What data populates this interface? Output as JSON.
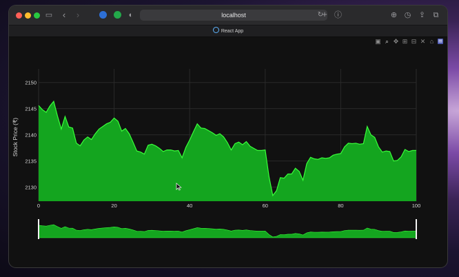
{
  "browser": {
    "url": "localhost",
    "tab_title": "React App"
  },
  "colors": {
    "fill": "#14a51f",
    "line": "#39ff3a",
    "grid": "#2a2a2a",
    "background": "#111111"
  },
  "modebar": {
    "icons": [
      "camera-icon",
      "zoom-icon",
      "pan-icon",
      "zoom-in-icon",
      "zoom-out-icon",
      "autoscale-icon",
      "reset-axes-icon",
      "plotly-logo-icon"
    ]
  },
  "chart_data": {
    "type": "area",
    "ylabel": "Stock Price (₹)",
    "xlabel": "",
    "xlim": [
      0,
      100
    ],
    "ylim": [
      2127.3,
      2152.6
    ],
    "x_ticks": [
      "0",
      "20",
      "40",
      "60",
      "80",
      "100"
    ],
    "y_ticks": [
      "2130",
      "2135",
      "2140",
      "2145",
      "2150"
    ],
    "x": [
      0,
      1,
      2,
      3,
      4,
      5,
      6,
      7,
      8,
      9,
      10,
      11,
      12,
      13,
      14,
      15,
      16,
      17,
      18,
      19,
      20,
      21,
      22,
      23,
      24,
      25,
      26,
      27,
      28,
      29,
      30,
      31,
      32,
      33,
      34,
      35,
      36,
      37,
      38,
      39,
      40,
      41,
      42,
      43,
      44,
      45,
      46,
      47,
      48,
      49,
      50,
      51,
      52,
      53,
      54,
      55,
      56,
      57,
      58,
      59,
      60,
      61,
      62,
      63,
      64,
      65,
      66,
      67,
      68,
      69,
      70,
      71,
      72,
      73,
      74,
      75,
      76,
      77,
      78,
      79,
      80,
      81,
      82,
      83,
      84,
      85,
      86,
      87,
      88,
      89,
      90,
      91,
      92,
      93,
      94,
      95,
      96,
      97,
      98,
      99,
      100
    ],
    "values": [
      2145.6,
      2144.8,
      2144.3,
      2145.5,
      2146.4,
      2143.6,
      2141.1,
      2143.5,
      2141.5,
      2141.3,
      2138.4,
      2137.9,
      2139.0,
      2139.6,
      2139.1,
      2140.2,
      2141.1,
      2141.6,
      2142.1,
      2142.4,
      2143.2,
      2142.6,
      2140.7,
      2141.2,
      2140.2,
      2138.6,
      2136.9,
      2136.7,
      2136.3,
      2138.0,
      2138.2,
      2137.9,
      2137.4,
      2136.8,
      2137.1,
      2137.1,
      2136.9,
      2137.0,
      2135.6,
      2137.6,
      2139.0,
      2140.6,
      2142.1,
      2141.3,
      2141.2,
      2140.8,
      2140.4,
      2139.9,
      2140.2,
      2139.6,
      2138.5,
      2137.1,
      2138.3,
      2138.6,
      2138.1,
      2138.7,
      2137.8,
      2137.4,
      2137.0,
      2137.0,
      2137.1,
      2132.0,
      2128.4,
      2129.3,
      2131.8,
      2131.7,
      2132.5,
      2132.5,
      2133.6,
      2133.0,
      2131.3,
      2134.5,
      2135.7,
      2135.4,
      2135.3,
      2135.6,
      2135.5,
      2135.6,
      2136.1,
      2136.3,
      2136.4,
      2137.7,
      2138.4,
      2138.3,
      2138.4,
      2138.2,
      2138.3,
      2141.6,
      2140.0,
      2139.5,
      2137.7,
      2136.7,
      2136.9,
      2136.8,
      2135.0,
      2135.1,
      2135.8,
      2137.2,
      2136.8,
      2137.0,
      2137.0
    ]
  }
}
